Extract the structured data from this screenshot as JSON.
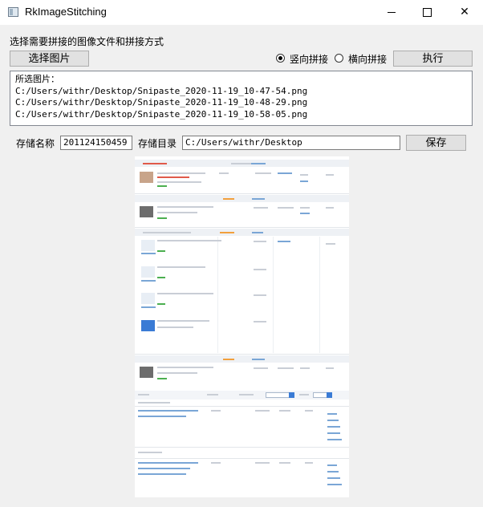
{
  "window": {
    "title": "RkImageStitching",
    "minimize_icon": "minimize-icon",
    "maximize_icon": "maximize-icon",
    "close_icon": "close-icon"
  },
  "prompt": "选择需要拼接的图像文件和拼接方式",
  "buttons": {
    "select": "选择图片",
    "execute": "执行",
    "save": "保存"
  },
  "mode": {
    "options": [
      "竖向拼接",
      "横向拼接"
    ],
    "selected": "竖向拼接"
  },
  "files": {
    "header": "所选图片：",
    "items": [
      "C:/Users/withr/Desktop/Snipaste_2020-11-19_10-47-54.png",
      "C:/Users/withr/Desktop/Snipaste_2020-11-19_10-48-29.png",
      "C:/Users/withr/Desktop/Snipaste_2020-11-19_10-58-05.png"
    ]
  },
  "save": {
    "name_label": "存储名称",
    "name_value": "201124150459",
    "dir_label": "存储目录",
    "dir_value": "C:/Users/withr/Desktop"
  }
}
